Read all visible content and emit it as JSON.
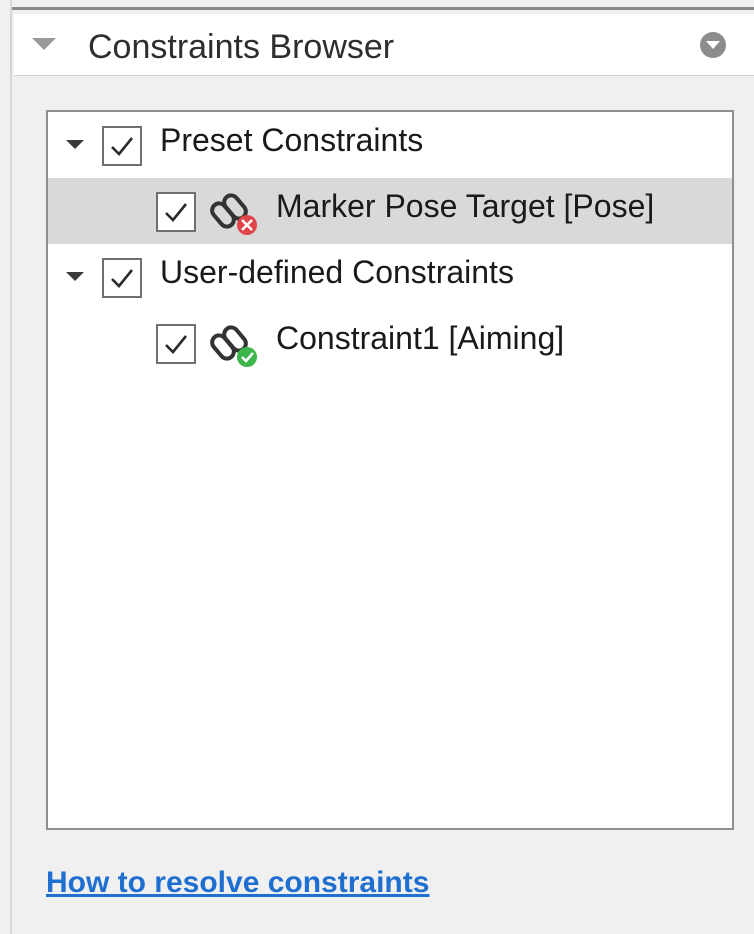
{
  "header": {
    "title": "Constraints Browser",
    "collapse_icon": "triangle-down-icon",
    "options_icon": "circle-chevron-down-icon"
  },
  "tree": {
    "groups": [
      {
        "label": "Preset Constraints",
        "checked": true,
        "expanded": true,
        "items": [
          {
            "label": "Marker Pose Target [Pose]",
            "checked": true,
            "status": "error",
            "icon": "chain-link-error-icon",
            "selected": true
          }
        ]
      },
      {
        "label": "User-defined Constraints",
        "checked": true,
        "expanded": true,
        "items": [
          {
            "label": "Constraint1 [Aiming]",
            "checked": true,
            "status": "ok",
            "icon": "chain-link-ok-icon",
            "selected": false
          }
        ]
      }
    ]
  },
  "footer": {
    "help_link": "How to resolve constraints"
  },
  "colors": {
    "link": "#1f6fd1",
    "selection": "#d9d9d9",
    "error": "#e0454b",
    "ok": "#3cb54a"
  }
}
